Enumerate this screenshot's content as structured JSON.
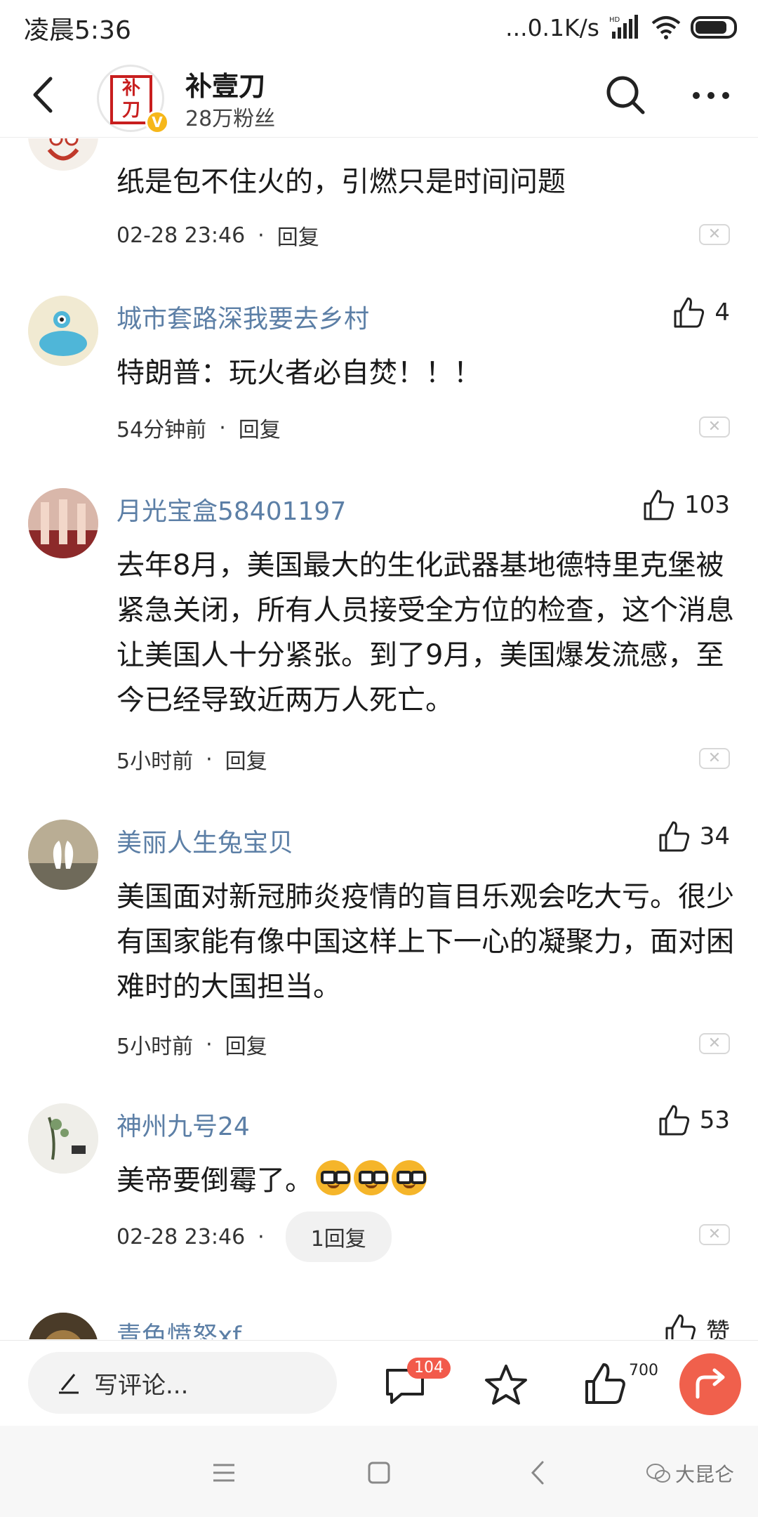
{
  "status_bar": {
    "time": "凌晨5:36",
    "network_speed": "...0.1K/s",
    "hd": "HD"
  },
  "header": {
    "account_name": "补壹刀",
    "followers": "28万粉丝",
    "logo_text_top": "补",
    "logo_text_bottom": "刀",
    "verified_mark": "V"
  },
  "comments": [
    {
      "username": "",
      "text": "纸是包不住火的，引燃只是时间问题",
      "time": "02-28 23:46",
      "reply_label": "回复",
      "likes": ""
    },
    {
      "username": "城市套路深我要去乡村",
      "text": "特朗普：玩火者必自焚！！！",
      "time": "54分钟前",
      "reply_label": "回复",
      "likes": "4"
    },
    {
      "username": "月光宝盒58401197",
      "text": "去年8月，美国最大的生化武器基地德特里克堡被紧急关闭，所有人员接受全方位的检查，这个消息让美国人十分紧张。到了9月，美国爆发流感，至今已经导致近两万人死亡。",
      "time": "5小时前",
      "reply_label": "回复",
      "likes": "103"
    },
    {
      "username": "美丽人生兔宝贝",
      "text": "美国面对新冠肺炎疫情的盲目乐观会吃大亏。很少有国家能有像中国这样上下一心的凝聚力，面对困难时的大国担当。",
      "time": "5小时前",
      "reply_label": "回复",
      "likes": "34"
    },
    {
      "username": "神州九号24",
      "text": "美帝要倒霉了。",
      "time": "02-28 23:46",
      "reply_label": "1回复",
      "likes": "53"
    },
    {
      "username": "青色愤怒xf",
      "text": "",
      "time": "",
      "reply_label": "",
      "likes": "赞"
    }
  ],
  "bottom_bar": {
    "write_placeholder": "写评论...",
    "comment_count": "104",
    "like_count": "700"
  },
  "watermark": "大昆仑",
  "colors": {
    "username": "#5c7fa6",
    "accent_red": "#f0604c",
    "badge_red": "#f25a4b"
  }
}
